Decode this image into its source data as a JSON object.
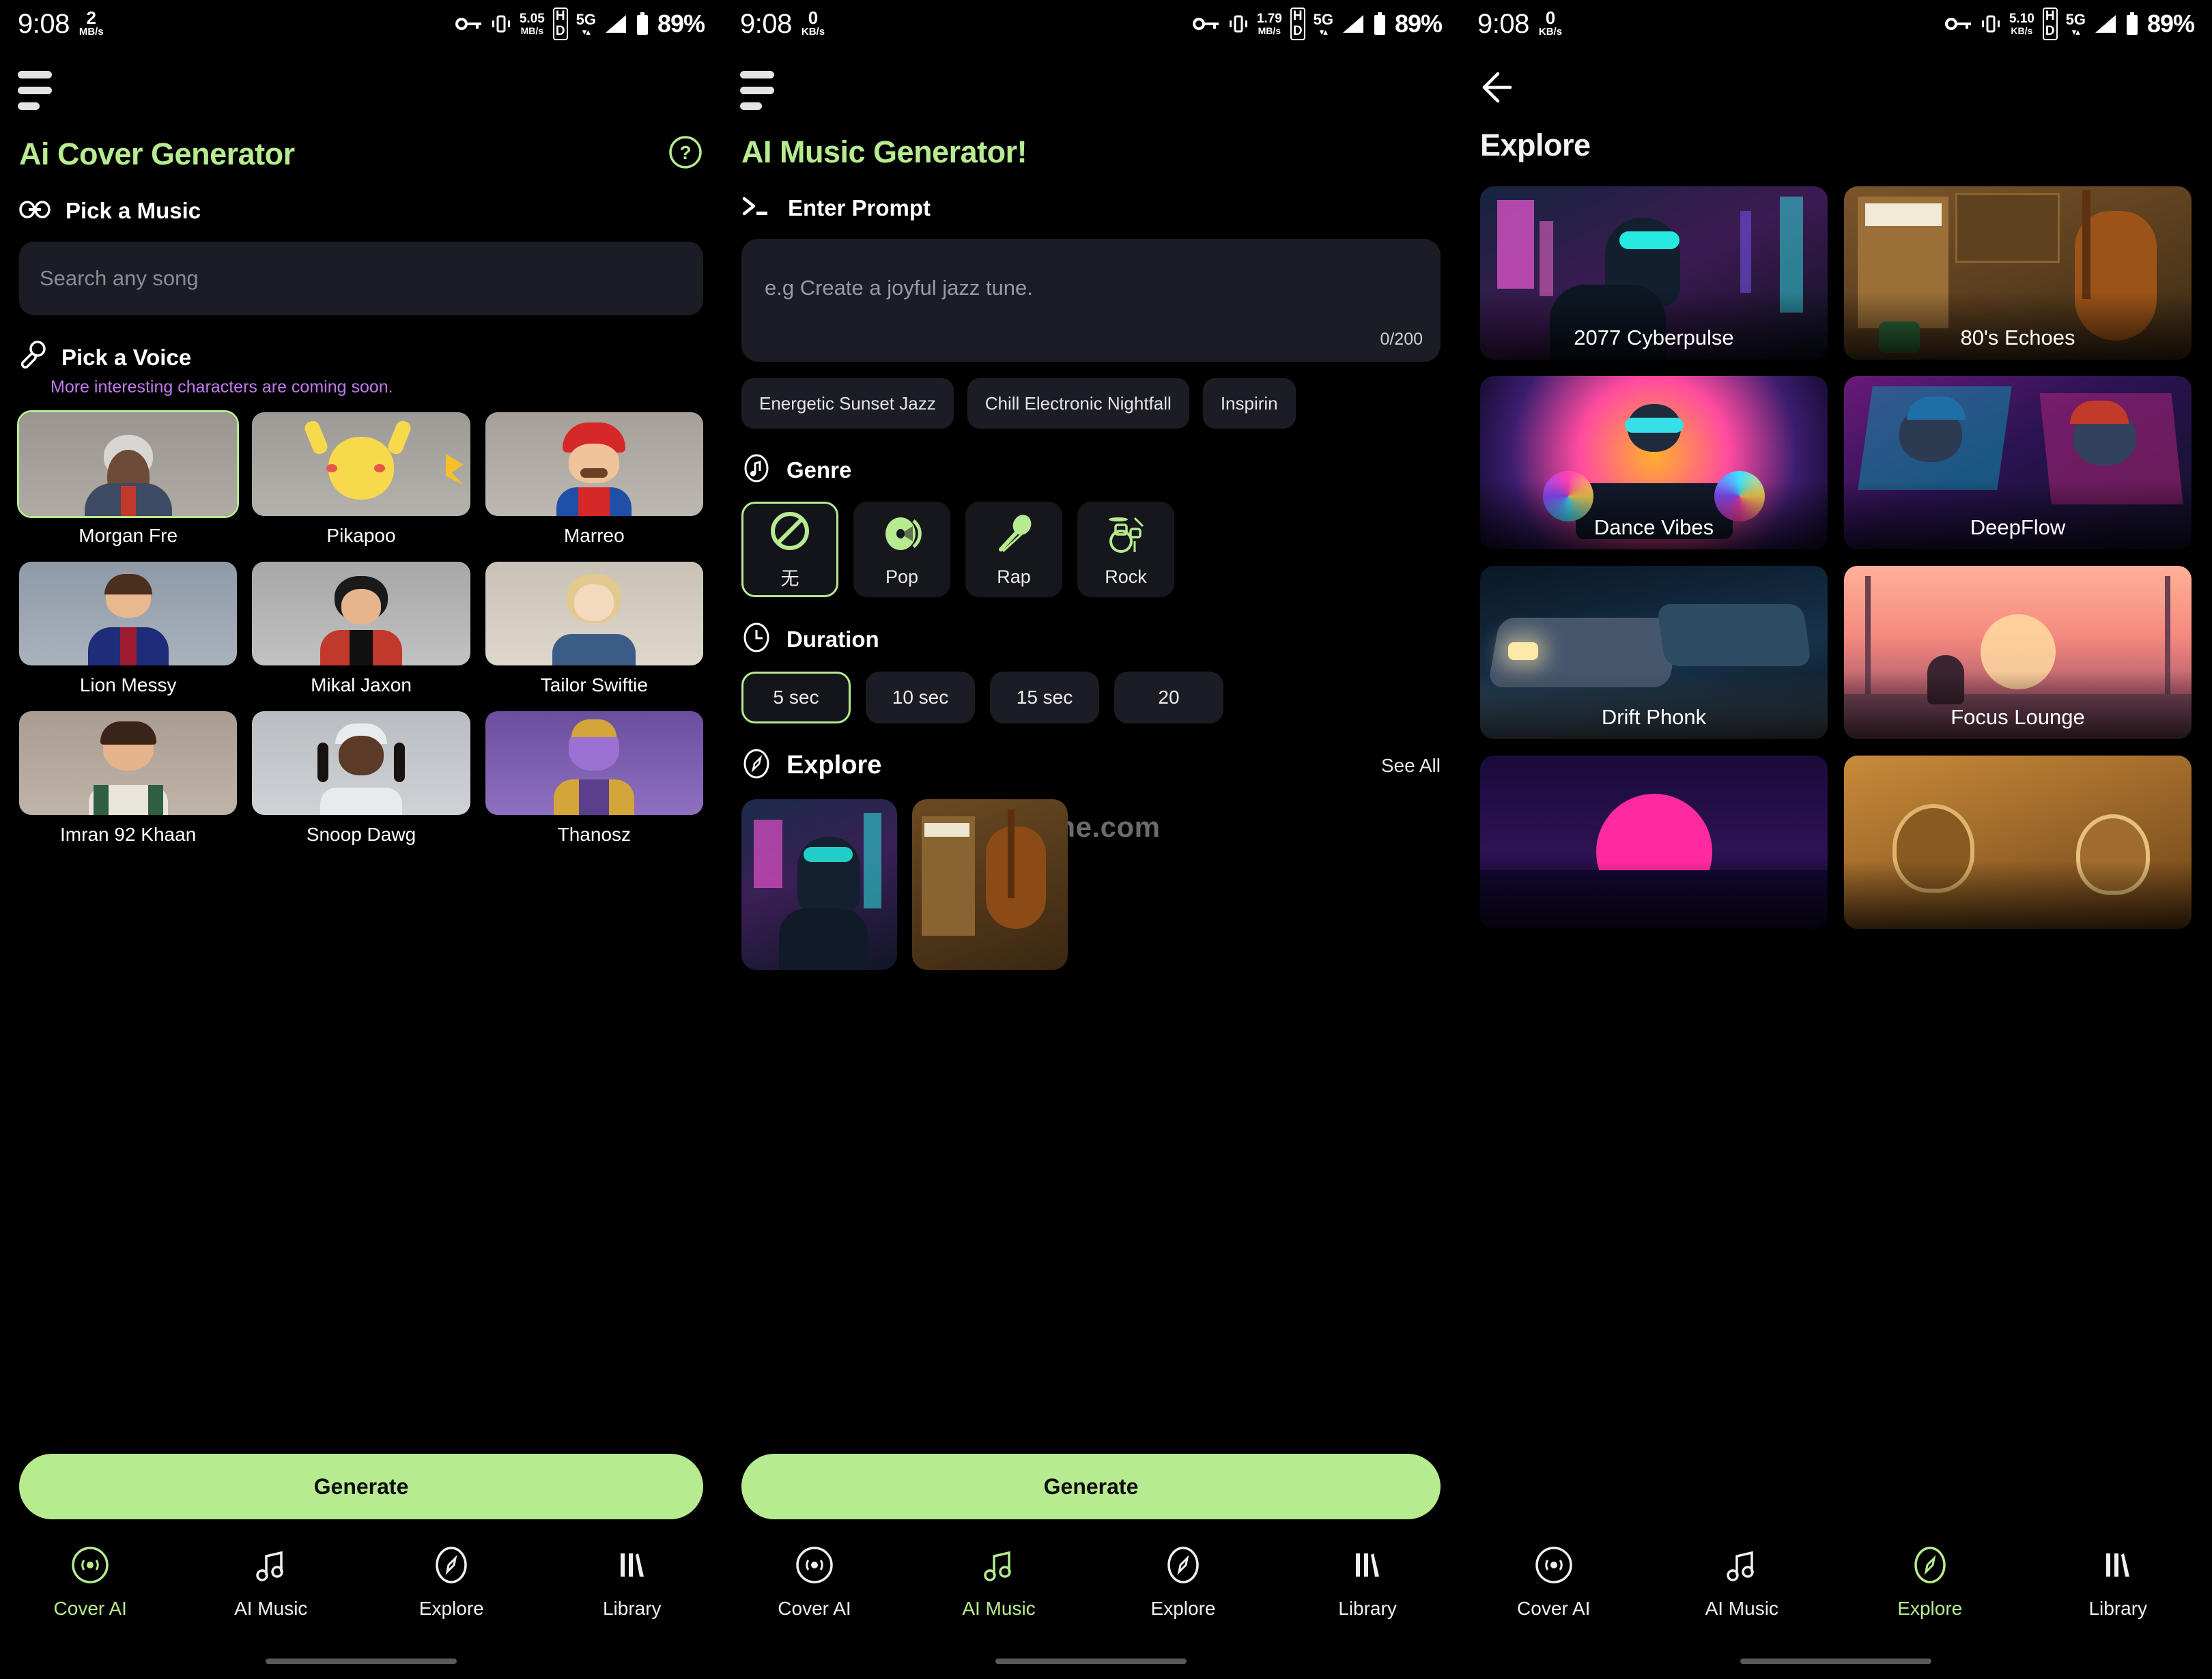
{
  "status_bars": [
    {
      "time": "9:08",
      "rate_value": "2",
      "rate_unit": "MB/s",
      "net_value": "5.05",
      "net_unit": "MB/s",
      "hd": "HD",
      "network": "5G",
      "battery": "89%"
    },
    {
      "time": "9:08",
      "rate_value": "0",
      "rate_unit": "KB/s",
      "net_value": "1.79",
      "net_unit": "MB/s",
      "hd": "HD",
      "network": "5G",
      "battery": "89%"
    },
    {
      "time": "9:08",
      "rate_value": "0",
      "rate_unit": "KB/s",
      "net_value": "5.10",
      "net_unit": "KB/s",
      "hd": "HD",
      "network": "5G",
      "battery": "89%"
    }
  ],
  "colors": {
    "accent": "#b7eb8f",
    "background": "#000000",
    "card": "#1c1c24",
    "purple": "#c27bee"
  },
  "screen1": {
    "title": "Ai Cover Generator",
    "pick_music_label": "Pick a Music",
    "search_placeholder": "Search any song",
    "pick_voice_label": "Pick a Voice",
    "coming_soon": "More interesting characters are coming soon.",
    "voices": [
      {
        "name": "Morgan Fre",
        "selected": true
      },
      {
        "name": "Pikapoo",
        "selected": false
      },
      {
        "name": "Marreo",
        "selected": false
      },
      {
        "name": "Lion Messy",
        "selected": false
      },
      {
        "name": "Mikal Jaxon",
        "selected": false
      },
      {
        "name": "Tailor Swiftie",
        "selected": false
      },
      {
        "name": "Imran 92 Khaan",
        "selected": false
      },
      {
        "name": "Snoop Dawg",
        "selected": false
      },
      {
        "name": "Thanosz",
        "selected": false
      }
    ],
    "generate_label": "Generate"
  },
  "screen2": {
    "title": "AI Music Generator!",
    "enter_prompt_label": "Enter Prompt",
    "prompt_placeholder": "e.g Create a joyful jazz tune.",
    "prompt_counter": "0/200",
    "suggestion_chips": [
      "Energetic Sunset Jazz",
      "Chill Electronic Nightfall",
      "Inspirin"
    ],
    "genre_label": "Genre",
    "genres": [
      {
        "label": "无",
        "icon": "none-icon",
        "selected": true
      },
      {
        "label": "Pop",
        "icon": "vinyl-icon",
        "selected": false
      },
      {
        "label": "Rap",
        "icon": "microphone-icon",
        "selected": false
      },
      {
        "label": "Rock",
        "icon": "drums-icon",
        "selected": false
      }
    ],
    "duration_label": "Duration",
    "durations": [
      {
        "label": "5 sec",
        "selected": true
      },
      {
        "label": "10 sec",
        "selected": false
      },
      {
        "label": "15 sec",
        "selected": false
      },
      {
        "label": "20",
        "selected": false
      }
    ],
    "explore_label": "Explore",
    "see_all_label": "See All",
    "watermark": "rjshe.com",
    "generate_label": "Generate"
  },
  "screen3": {
    "title": "Explore",
    "cards": [
      {
        "title": "2077 Cyberpulse",
        "art": "cyberpunk"
      },
      {
        "title": "80's Echoes",
        "art": "cello"
      },
      {
        "title": "Dance Vibes",
        "art": "dj"
      },
      {
        "title": "DeepFlow",
        "art": "rappers"
      },
      {
        "title": "Drift Phonk",
        "art": "cars"
      },
      {
        "title": "Focus Lounge",
        "art": "sunsetroom"
      },
      {
        "title": "",
        "art": "retrosun"
      },
      {
        "title": "",
        "art": "tabla"
      }
    ]
  },
  "bottom_nav": [
    {
      "label": "Cover AI",
      "icon": "vinyl-record-icon"
    },
    {
      "label": "AI Music",
      "icon": "music-note-icon"
    },
    {
      "label": "Explore",
      "icon": "compass-icon"
    },
    {
      "label": "Library",
      "icon": "books-icon"
    }
  ],
  "active_nav": [
    0,
    1,
    2
  ]
}
